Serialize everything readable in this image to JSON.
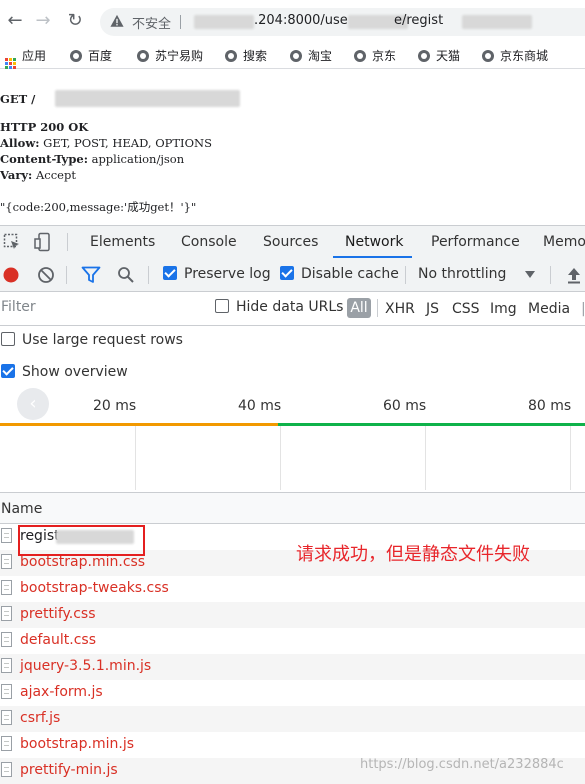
{
  "browser": {
    "back_label": "←",
    "forward_label": "→",
    "reload_label": "↻",
    "security_label": "不安全",
    "url_visible_part1": ".204:8000/use",
    "url_visible_part2": "e/regist",
    "bookmarks": [
      {
        "label": "应用",
        "icon": "apps-grid-icon"
      },
      {
        "label": "百度",
        "icon": "globe-icon"
      },
      {
        "label": "苏宁易购",
        "icon": "globe-icon"
      },
      {
        "label": "搜索",
        "icon": "globe-icon"
      },
      {
        "label": "淘宝",
        "icon": "globe-icon"
      },
      {
        "label": "京东",
        "icon": "globe-icon"
      },
      {
        "label": "天猫",
        "icon": "globe-icon"
      },
      {
        "label": "京东商城",
        "icon": "globe-icon"
      }
    ]
  },
  "response": {
    "request_line": "GET /",
    "status_line": "HTTP 200 OK",
    "headers": [
      {
        "key": "Allow:",
        "value": " GET, POST, HEAD, OPTIONS"
      },
      {
        "key": "Content-Type:",
        "value": " application/json"
      },
      {
        "key": "Vary:",
        "value": " Accept"
      }
    ],
    "body": "\"{code:200,message:'成功get！'}\""
  },
  "devtools": {
    "tabs": [
      "Elements",
      "Console",
      "Sources",
      "Network",
      "Performance",
      "Memo"
    ],
    "active_tab": "Network",
    "toolbar": {
      "preserve_log": "Preserve log",
      "disable_cache": "Disable cache",
      "throttling": "No throttling"
    },
    "filter": {
      "placeholder": "Filter",
      "hide_data_urls": "Hide data URLs",
      "types": [
        "All",
        "XHR",
        "JS",
        "CSS",
        "Img",
        "Media"
      ]
    },
    "options": {
      "large_rows": "Use large request rows",
      "show_overview": "Show overview"
    },
    "overview_ticks": [
      "20 ms",
      "40 ms",
      "60 ms",
      "80 ms"
    ],
    "name_header": "Name",
    "requests": [
      {
        "name": "regist",
        "status": "ok"
      },
      {
        "name": "bootstrap.min.css",
        "status": "failed"
      },
      {
        "name": "bootstrap-tweaks.css",
        "status": "failed"
      },
      {
        "name": "prettify.css",
        "status": "failed"
      },
      {
        "name": "default.css",
        "status": "failed"
      },
      {
        "name": "jquery-3.5.1.min.js",
        "status": "failed"
      },
      {
        "name": "ajax-form.js",
        "status": "failed"
      },
      {
        "name": "csrf.js",
        "status": "failed"
      },
      {
        "name": "bootstrap.min.js",
        "status": "failed"
      },
      {
        "name": "prettify-min.js",
        "status": "failed"
      }
    ]
  },
  "annotation": "请求成功，但是静态文件失败",
  "watermark": "https://blog.csdn.net/a232884c",
  "colors": {
    "failed": "#d93025",
    "annotation": "#e8262b",
    "accent": "#1a73e8"
  }
}
